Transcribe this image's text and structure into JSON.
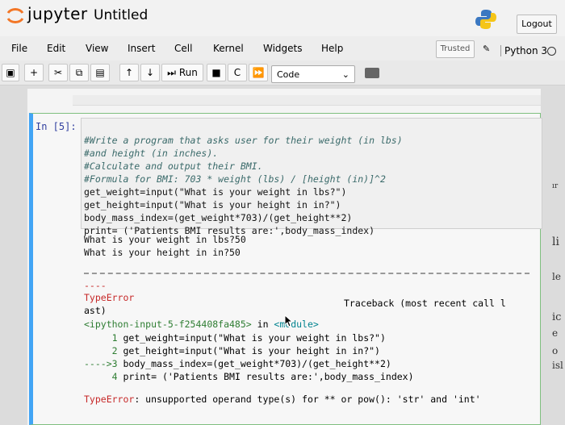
{
  "header": {
    "brand": "jupyter",
    "notebook_title": "Untitled",
    "logout_label": "Logout"
  },
  "menubar": {
    "items": [
      "File",
      "Edit",
      "View",
      "Insert",
      "Cell",
      "Kernel",
      "Widgets",
      "Help"
    ],
    "trusted_label": "Trusted",
    "kernel_name": "Python 3"
  },
  "toolbar": {
    "run_label": "Run",
    "cell_type": "Code"
  },
  "cell": {
    "prompt": "In [5]:",
    "source_lines": [
      "#Write a program that asks user for their weight (in lbs)",
      "#and height (in inches).",
      "#Calculate and output their BMI.",
      "#Formula for BMI: 703 * weight (lbs) / [height (in)]^2",
      "get_weight=input(\"What is your weight in lbs?\")",
      "get_height=input(\"What is your height in in?\")",
      "body_mass_index=(get_weight*703)/(get_height**2)",
      "print= ('Patients BMI results are:',body_mass_index)"
    ],
    "stdout_lines": [
      "What is your weight in lbs?50",
      "What is your height in in?50"
    ]
  },
  "traceback": {
    "short_dash": "----",
    "error_name": "TypeError",
    "header_right": "Traceback (most recent call l",
    "header_wrap": "ast)",
    "location": "<ipython-input-5-f254408fa485>",
    "location_in": " in ",
    "location_module": "<module>",
    "lines": [
      {
        "arrow": "     ",
        "num": "1",
        "text": " get_weight=input(\"What is your weight in lbs?\")"
      },
      {
        "arrow": "     ",
        "num": "2",
        "text": " get_height=input(\"What is your height in in?\")"
      },
      {
        "arrow": "---->",
        "num": "3",
        "text": " body_mass_index=(get_weight*703)/(get_height**2)"
      },
      {
        "arrow": "     ",
        "num": "4",
        "text": " print= ('Patients BMI results are:',body_mass_index)"
      }
    ],
    "final_error_name": "TypeError",
    "final_error_msg": ": unsupported operand type(s) for ** or pow(): 'str' and 'int'"
  },
  "side_fragments": [
    "ır",
    "li",
    "le",
    "ic",
    "e",
    "o",
    "isl"
  ]
}
